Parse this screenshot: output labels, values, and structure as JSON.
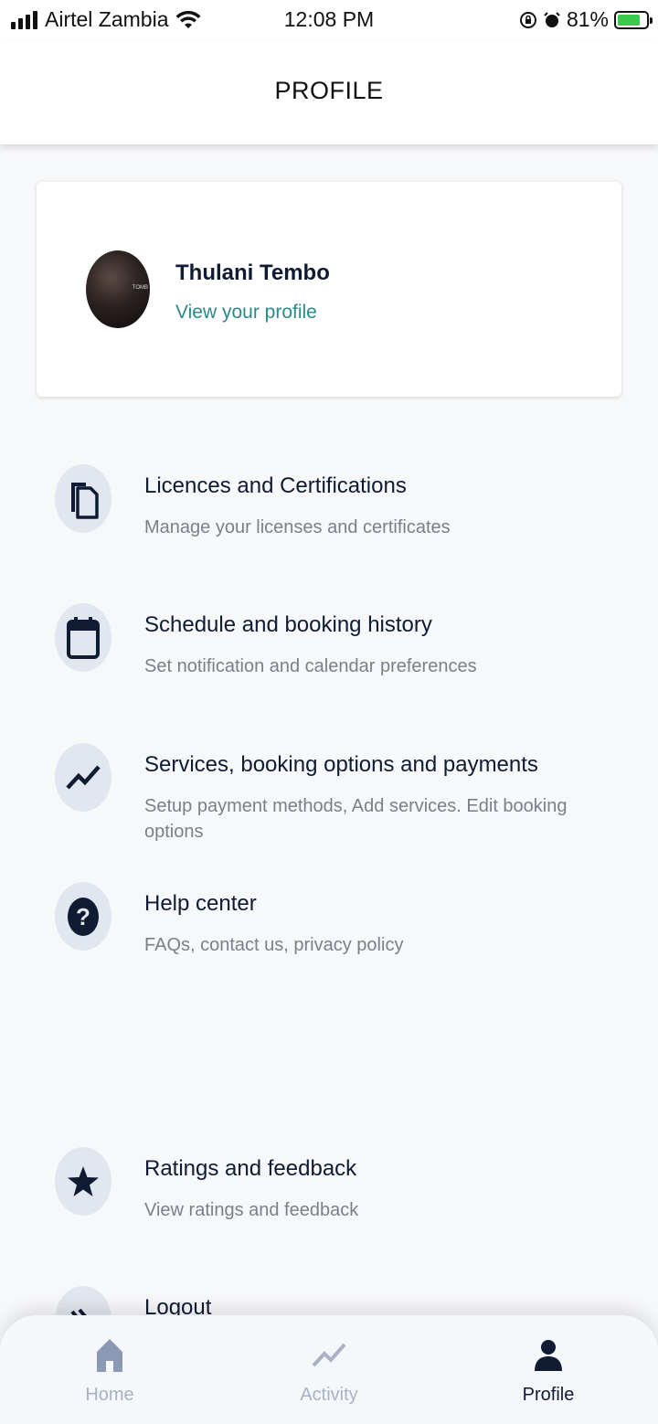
{
  "status_bar": {
    "carrier": "Airtel Zambia",
    "time": "12:08 PM",
    "battery": "81%",
    "battery_level": 0.81
  },
  "header": {
    "title": "PROFILE"
  },
  "profile": {
    "name": "Thulani Tembo",
    "link": "View your profile",
    "avatar_text": "TOMB"
  },
  "menu": [
    {
      "title": "Licences and Certifications",
      "subtitle": "Manage your licenses and certificates",
      "icon": "copy-icon"
    },
    {
      "title": "Schedule and booking history",
      "subtitle": "Set notification and calendar preferences",
      "icon": "calendar-icon"
    },
    {
      "title": "Services, booking options and payments",
      "subtitle": "Setup payment methods, Add services. Edit booking options",
      "icon": "trend-icon"
    },
    {
      "title": "Help center",
      "subtitle": "FAQs, contact us, privacy policy",
      "icon": "help-icon"
    },
    {
      "title": "Ratings and feedback",
      "subtitle": "View ratings and feedback",
      "icon": "star-icon"
    },
    {
      "title": "Logout",
      "subtitle": "",
      "icon": "logout-icon"
    }
  ],
  "nav": {
    "home": "Home",
    "activity": "Activity",
    "profile": "Profile"
  },
  "colors": {
    "accent": "#2a8a8a",
    "dark": "#0f1b33",
    "inactive": "#a9b2c2"
  }
}
